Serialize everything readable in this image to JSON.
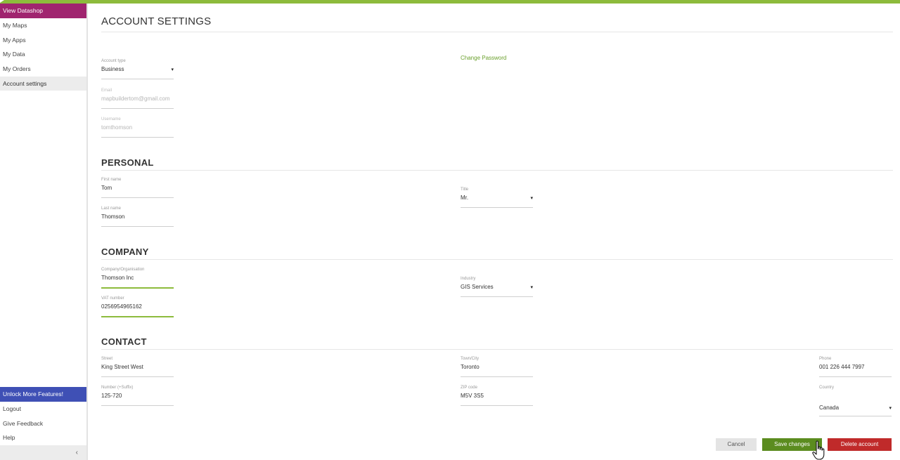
{
  "sidebar": {
    "view_datashop": "View Datashop",
    "items": [
      {
        "label": "My Maps"
      },
      {
        "label": "My Apps"
      },
      {
        "label": "My Data"
      },
      {
        "label": "My Orders"
      },
      {
        "label": "Account settings"
      }
    ],
    "unlock": "Unlock More Features!",
    "bottom": [
      {
        "label": "Logout"
      },
      {
        "label": "Give Feedback"
      },
      {
        "label": "Help"
      }
    ],
    "collapse_icon": "‹"
  },
  "page": {
    "title": "ACCOUNT SETTINGS",
    "change_password": "Change Password"
  },
  "account": {
    "account_type": {
      "label": "Account type",
      "value": "Business"
    },
    "email": {
      "label": "Email",
      "value": "mapbuildertom@gmail.com"
    },
    "username": {
      "label": "Username",
      "value": "tomthomson"
    }
  },
  "personal": {
    "heading": "PERSONAL",
    "first_name": {
      "label": "First name",
      "value": "Tom"
    },
    "last_name": {
      "label": "Last name",
      "value": "Thomson"
    },
    "title": {
      "label": "Title",
      "value": "Mr."
    }
  },
  "company": {
    "heading": "COMPANY",
    "organisation": {
      "label": "Company/Organisation",
      "value": "Thomson Inc"
    },
    "vat": {
      "label": "VAT number",
      "value": "0256954965162"
    },
    "industry": {
      "label": "Industry",
      "value": "GIS Services"
    }
  },
  "contact": {
    "heading": "CONTACT",
    "street": {
      "label": "Street",
      "value": "King Street West"
    },
    "number": {
      "label": "Number (+Suffix)",
      "value": "125-720"
    },
    "town": {
      "label": "Town/City",
      "value": "Toronto"
    },
    "zip": {
      "label": "ZIP code",
      "value": "M5V 3S5"
    },
    "phone": {
      "label": "Phone",
      "value": "001 226 444 7997"
    },
    "country": {
      "label": "Country",
      "value": "Canada"
    }
  },
  "actions": {
    "cancel": "Cancel",
    "save": "Save changes",
    "delete": "Delete account"
  },
  "colors": {
    "accent_green": "#8dbb3c",
    "datashop_magenta": "#a0246f",
    "unlock_blue": "#3f50b5",
    "save_green": "#5b8c1f",
    "delete_red": "#c02a2a"
  },
  "dropdown_icon": "▾"
}
